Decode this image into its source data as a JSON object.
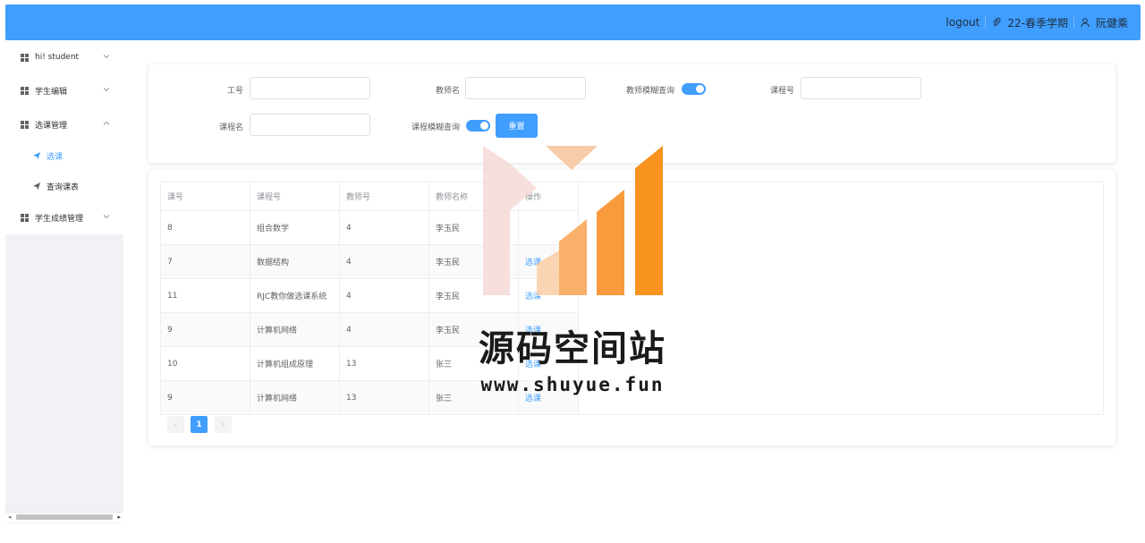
{
  "header": {
    "logout": "logout",
    "term": "22-春季学期",
    "user": "阮健乘",
    "icons": [
      "paperclip-icon",
      "user-icon"
    ]
  },
  "sidebar": {
    "items": [
      {
        "label": "hi! student",
        "expanded": false
      },
      {
        "label": "学生编辑",
        "expanded": false
      },
      {
        "label": "选课管理",
        "expanded": true
      },
      {
        "label": "选课",
        "sub": true,
        "active": true
      },
      {
        "label": "查询课表",
        "sub": true,
        "active": false
      },
      {
        "label": "学生成绩管理",
        "expanded": false
      }
    ]
  },
  "search": {
    "labels": {
      "teacher_id": "工号",
      "teacher_name": "教师名",
      "teacher_fuzzy": "教师模糊查询",
      "course_no": "课程号",
      "course_name": "课程名",
      "course_fuzzy": "课程模糊查询"
    },
    "teacher_fuzzy_on": true,
    "course_fuzzy_on": true,
    "reset_label": "重置"
  },
  "table": {
    "headers": [
      "课号",
      "课程号",
      "教师号",
      "教师名称",
      "操作"
    ],
    "rows": [
      [
        "8",
        "组合数学",
        "4",
        "李玉民",
        ""
      ],
      [
        "7",
        "数据结构",
        "4",
        "李玉民",
        "选课"
      ],
      [
        "11",
        "RJC教你做选课系统",
        "4",
        "李玉民",
        "选课"
      ],
      [
        "9",
        "计算机网络",
        "4",
        "李玉民",
        "选课"
      ],
      [
        "10",
        "计算机组成原理",
        "13",
        "张三",
        "选课"
      ],
      [
        "9",
        "计算机网络",
        "13",
        "张三",
        "选课"
      ]
    ]
  },
  "pagination": {
    "prev": "‹",
    "current": "1",
    "next": "›"
  },
  "watermark": {
    "title": "源码空间站",
    "url": "www.shuyue.fun"
  },
  "colors": {
    "primary": "#409eff",
    "watermark_orange": "#f7931e"
  }
}
